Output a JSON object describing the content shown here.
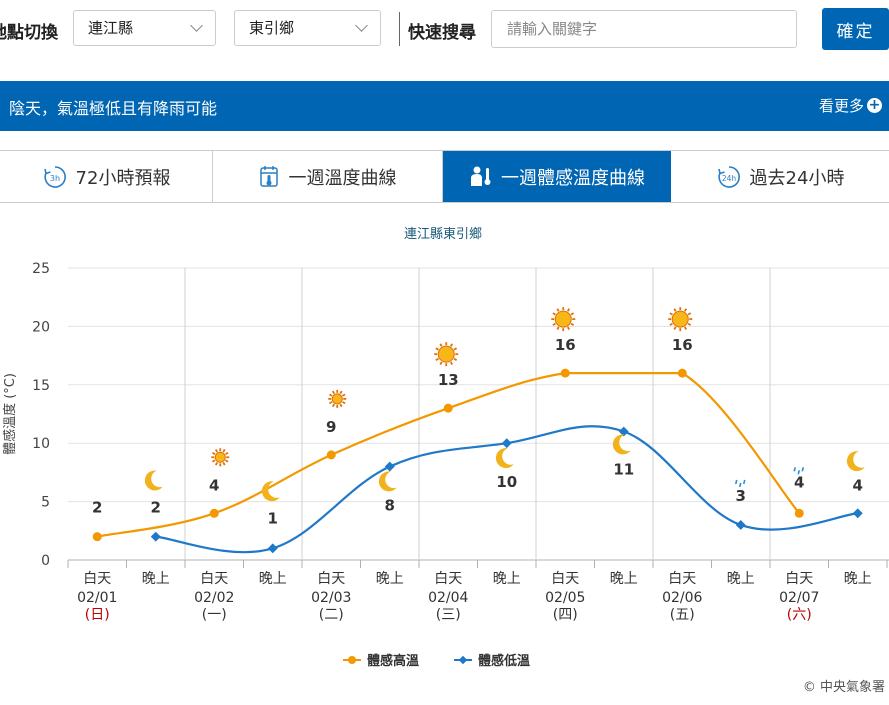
{
  "header": {
    "location_label": "地點切換",
    "county": "連江縣",
    "township": "東引鄉",
    "search_label": "快速搜尋",
    "search_placeholder": "請輸入關鍵字",
    "confirm_label": "確定"
  },
  "banner": {
    "text": "陰天，氣溫極低且有降雨可能",
    "more_label": "看更多"
  },
  "tabs": [
    {
      "label": "72小時預報",
      "icon": "clock-3h-icon",
      "active": false
    },
    {
      "label": "一週溫度曲線",
      "icon": "thermometer-calendar-icon",
      "active": false
    },
    {
      "label": "一週體感溫度曲線",
      "icon": "person-thermometer-icon",
      "active": true
    },
    {
      "label": "過去24小時",
      "icon": "clock-24h-icon",
      "active": false
    }
  ],
  "chart_data": {
    "type": "line",
    "title": "連江縣東引鄉",
    "ylabel": "體感溫度 (°C)",
    "ylim": [
      0,
      25
    ],
    "yticks": [
      0,
      5,
      10,
      15,
      20,
      25
    ],
    "categories": [
      "白天",
      "晚上",
      "白天",
      "晚上",
      "白天",
      "晚上",
      "白天",
      "晚上",
      "白天",
      "晚上",
      "白天",
      "晚上",
      "白天",
      "晚上"
    ],
    "dates": [
      {
        "date": "02/01",
        "weekday": "(日)",
        "holiday": true
      },
      {
        "date": "02/02",
        "weekday": "(一)",
        "holiday": false
      },
      {
        "date": "02/03",
        "weekday": "(二)",
        "holiday": false
      },
      {
        "date": "02/04",
        "weekday": "(三)",
        "holiday": false
      },
      {
        "date": "02/05",
        "weekday": "(四)",
        "holiday": false
      },
      {
        "date": "02/06",
        "weekday": "(五)",
        "holiday": false
      },
      {
        "date": "02/07",
        "weekday": "(六)",
        "holiday": true
      }
    ],
    "series": [
      {
        "name": "體感高溫",
        "color": "#f39800",
        "values": [
          2,
          null,
          4,
          null,
          9,
          null,
          13,
          null,
          16,
          null,
          16,
          null,
          4,
          null
        ]
      },
      {
        "name": "體感低溫",
        "color": "#1f78c8",
        "values": [
          null,
          2,
          null,
          1,
          null,
          8,
          null,
          10,
          null,
          11,
          null,
          3,
          null,
          4
        ]
      }
    ],
    "weather_icons": [
      "cloudy",
      "moon-cloud",
      "partly-cloudy",
      "moon-cloud",
      "partly-cloudy",
      "moon-cloud",
      "sunny-cloud",
      "moon-cloud",
      "sunny-cloud",
      "moon-cloud",
      "sunny-cloud",
      "cloud-rain",
      "cloud-rain",
      "moon-cloud"
    ],
    "holiday_color": "#c00000"
  },
  "footer": {
    "credit": "© 中央氣象署"
  }
}
